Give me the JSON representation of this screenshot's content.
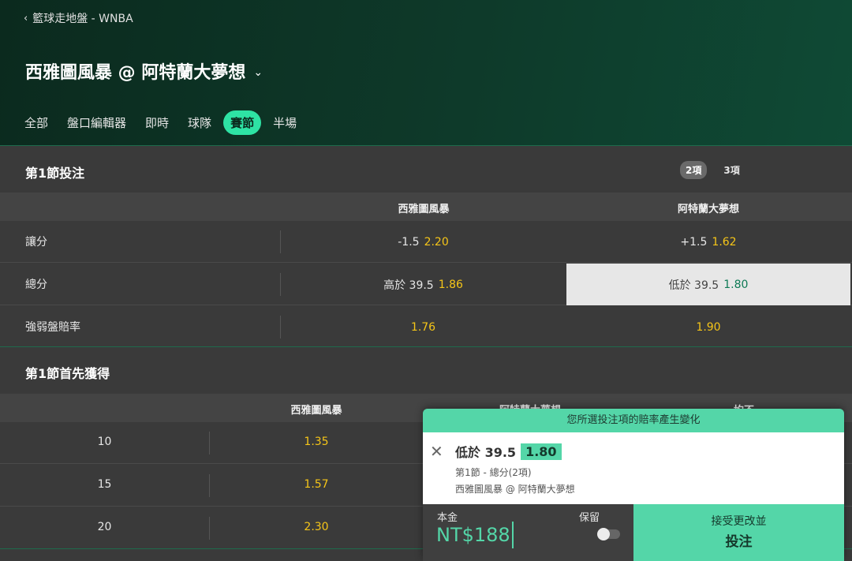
{
  "header": {
    "back_icon": "chevron-left-icon",
    "breadcrumb": "籃球走地盤 - WNBA",
    "match_title": "西雅圖風暴 @ 阿特蘭大夢想",
    "tabs": [
      "全部",
      "盤口編輯器",
      "即時",
      "球隊",
      "賽節",
      "半場"
    ],
    "active_tab": "賽節"
  },
  "section1": {
    "title": "第1節投注",
    "ways": [
      "2項",
      "3項"
    ],
    "active_way": "2項",
    "teams": [
      "西雅圖風暴",
      "阿特蘭大夢想"
    ],
    "rows": [
      {
        "label": "讓分",
        "home_line": "-1.5",
        "home_odds": "2.20",
        "away_line": "+1.5",
        "away_odds": "1.62"
      },
      {
        "label": "總分",
        "home_line": "高於 39.5",
        "home_odds": "1.86",
        "away_line": "低於 39.5",
        "away_odds": "1.80"
      },
      {
        "label": "強弱盤賠率",
        "home_line": "",
        "home_odds": "1.76",
        "away_line": "",
        "away_odds": "1.90"
      }
    ]
  },
  "section2": {
    "title": "第1節首先獲得",
    "columns": [
      "西雅圖風暴",
      "阿特蘭大夢想",
      "均不"
    ],
    "rows": [
      {
        "points": "10",
        "home_odds": "1.35"
      },
      {
        "points": "15",
        "home_odds": "1.57"
      },
      {
        "points": "20",
        "home_odds": "2.30"
      }
    ]
  },
  "betslip": {
    "banner": "您所選投注項的賠率產生變化",
    "selection": "低於 39.5",
    "odds": "1.80",
    "market": "第1節 - 總分(2項)",
    "event": "西雅圖風暴 @ 阿特蘭大夢想",
    "stake_label": "本金",
    "stake_value": "NT$188",
    "keep_label": "保留",
    "keep_enabled": false,
    "accept_label": "接受更改並",
    "place_label": "投注"
  },
  "colors": {
    "accent": "#2ee3a4",
    "odds": "#f5c518",
    "slip_green": "#54d6a8"
  }
}
